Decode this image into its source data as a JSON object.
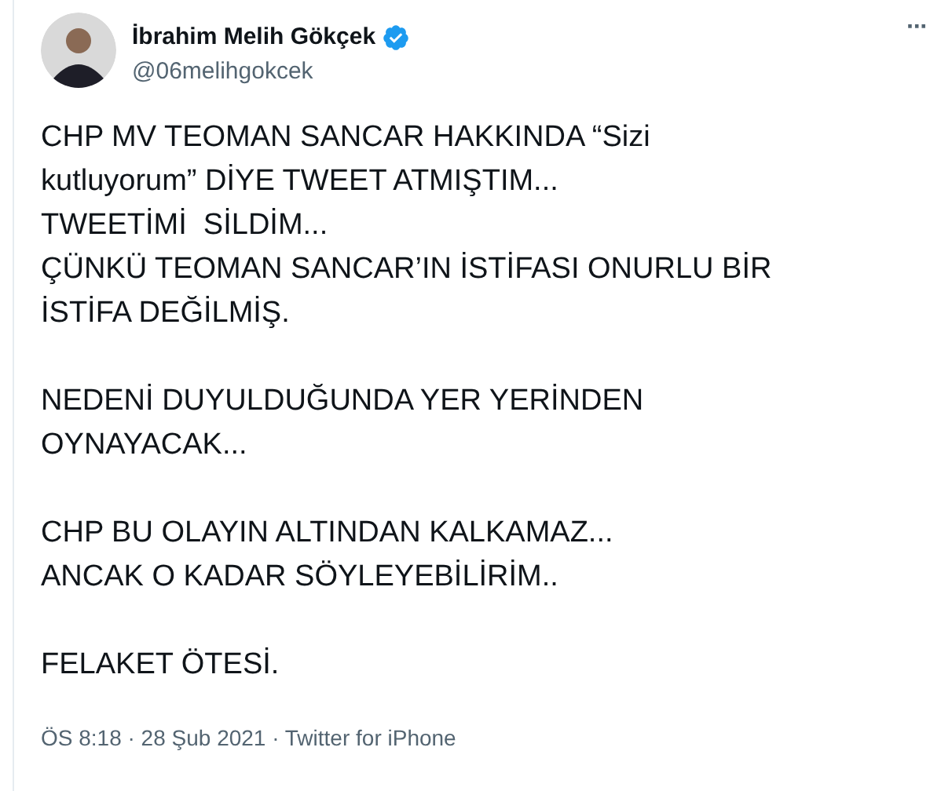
{
  "author": {
    "name": "İbrahim Melih Gökçek",
    "verified": true,
    "handle": "@06melihgokcek"
  },
  "more": "···",
  "paragraphs": [
    [
      "CHP MV TEOMAN SANCAR HAKKINDA “Sizi",
      "kutluyorum” DİYE TWEET ATMIŞTIM...",
      "TWEETİMİ  SİLDİM...",
      "ÇÜNKÜ TEOMAN SANCAR’IN İSTİFASI ONURLU BİR",
      "İSTİFA DEĞİLMİŞ."
    ],
    [
      "NEDENİ DUYULDUĞUNDA YER YERİNDEN",
      "OYNAYACAK..."
    ],
    [
      "CHP BU OLAYIN ALTINDAN KALKAMAZ...",
      "ANCAK O KADAR SÖYLEYEBİLİRİM.."
    ],
    [
      "FELAKET ÖTESİ."
    ]
  ],
  "footer": "ÖS 8:18 · 28 Şub 2021 · Twitter for iPhone"
}
